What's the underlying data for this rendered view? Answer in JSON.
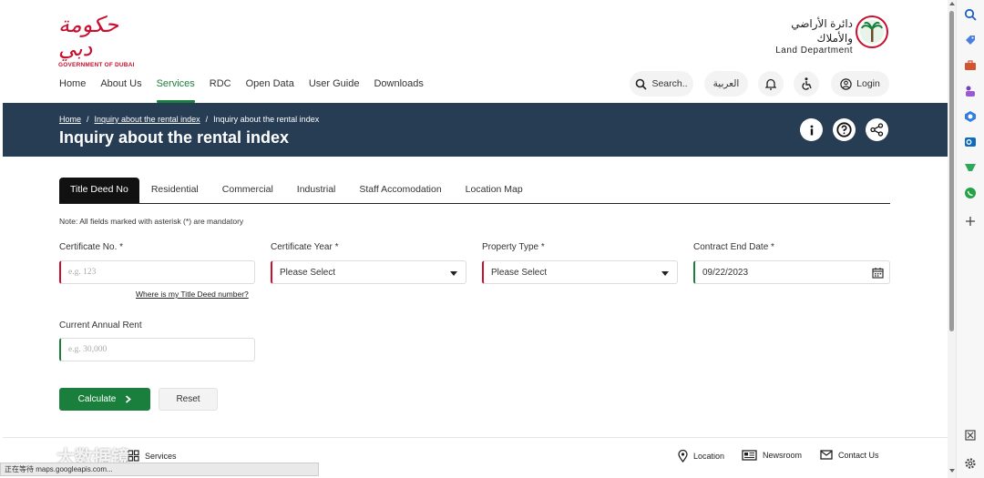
{
  "header": {
    "gov_logo_text": "حكومة دبي",
    "gov_logo_caption": "GOVERNMENT OF DUBAI",
    "land_logo_ar": "دائرة الأراضي والأملاك",
    "land_logo_en": "Land Department",
    "nav": [
      {
        "label": "Home"
      },
      {
        "label": "About Us"
      },
      {
        "label": "Services",
        "active": true
      },
      {
        "label": "RDC"
      },
      {
        "label": "Open Data"
      },
      {
        "label": "User Guide"
      },
      {
        "label": "Downloads"
      }
    ],
    "search_label": "Search..",
    "lang_label": "العربية",
    "login_label": "Login"
  },
  "banner": {
    "crumbs": [
      "Home",
      "Inquiry about the rental index",
      "Inquiry about the rental index"
    ],
    "separator": "/",
    "title": "Inquiry about the rental index"
  },
  "tabs": [
    {
      "label": "Title Deed No",
      "active": true
    },
    {
      "label": "Residential"
    },
    {
      "label": "Commercial"
    },
    {
      "label": "Industrial"
    },
    {
      "label": "Staff Accomodation"
    },
    {
      "label": "Location Map"
    }
  ],
  "form": {
    "note": "Note: All fields marked with asterisk (*) are mandatory",
    "certificate_no": {
      "label": "Certificate No. *",
      "placeholder": "e.g. 123"
    },
    "certificate_year": {
      "label": "Certificate Year *",
      "value": "Please Select"
    },
    "property_type": {
      "label": "Property Type *",
      "value": "Please Select"
    },
    "contract_end_date": {
      "label": "Contract End Date *",
      "value": "09/22/2023"
    },
    "help_link": "Where is my Title Deed number?",
    "current_annual_rent": {
      "label": "Current Annual Rent",
      "placeholder": "e.g. 30,000"
    },
    "calculate_label": "Calculate",
    "reset_label": "Reset"
  },
  "bottom": {
    "services_label": "Services",
    "location_label": "Location",
    "newsroom_label": "Newsroom",
    "contact_label": "Contact Us",
    "status_url": "正在等待 maps.googleapis.com...",
    "watermark": "大数据镜"
  },
  "colors": {
    "accent_green": "#1a7f3c",
    "banner_navy": "#263d54",
    "dubai_red": "#c8102e"
  }
}
